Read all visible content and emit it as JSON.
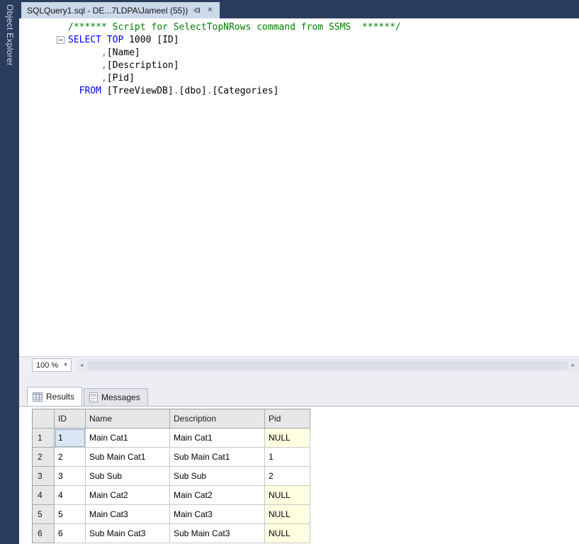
{
  "autohide": {
    "object_explorer_label": "Object Explorer"
  },
  "tab": {
    "title": "SQLQuery1.sql - DE...7LDPA\\Jameel (55))"
  },
  "icons": {
    "close": "✕",
    "caret_down": "▼",
    "scroll_left": "◄",
    "scroll_right": "►"
  },
  "editor": {
    "zoom_level": "100 %",
    "code_lines": [
      [
        [
          "comment",
          "/****** Script for SelectTopNRows command from SSMS  ******/"
        ]
      ],
      [
        [
          "kw",
          "SELECT"
        ],
        [
          "plain",
          " "
        ],
        [
          "kw",
          "TOP"
        ],
        [
          "plain",
          " "
        ],
        [
          "num",
          "1000"
        ],
        [
          "plain",
          " [ID]"
        ]
      ],
      [
        [
          "plain",
          "      "
        ],
        [
          "op",
          ","
        ],
        [
          "plain",
          "[Name]"
        ]
      ],
      [
        [
          "plain",
          "      "
        ],
        [
          "op",
          ","
        ],
        [
          "plain",
          "[Description]"
        ]
      ],
      [
        [
          "plain",
          "      "
        ],
        [
          "op",
          ","
        ],
        [
          "plain",
          "[Pid]"
        ]
      ],
      [
        [
          "plain",
          "  "
        ],
        [
          "kw",
          "FROM"
        ],
        [
          "plain",
          " [TreeViewDB]"
        ],
        [
          "op",
          "."
        ],
        [
          "plain",
          "[dbo]"
        ],
        [
          "op",
          "."
        ],
        [
          "plain",
          "[Categories]"
        ]
      ]
    ]
  },
  "results": {
    "tabs": [
      {
        "label": "Results"
      },
      {
        "label": "Messages"
      }
    ],
    "grid": {
      "columns": [
        "ID",
        "Name",
        "Description",
        "Pid"
      ],
      "rows": [
        {
          "num": "1",
          "cells": [
            "1",
            "Main Cat1",
            "Main Cat1",
            "NULL"
          ]
        },
        {
          "num": "2",
          "cells": [
            "2",
            "Sub Main Cat1",
            "Sub Main Cat1",
            "1"
          ]
        },
        {
          "num": "3",
          "cells": [
            "3",
            "Sub Sub",
            "Sub Sub",
            "2"
          ]
        },
        {
          "num": "4",
          "cells": [
            "4",
            "Main Cat2",
            "Main Cat2",
            "NULL"
          ]
        },
        {
          "num": "5",
          "cells": [
            "5",
            "Main Cat3",
            "Main Cat3",
            "NULL"
          ]
        },
        {
          "num": "6",
          "cells": [
            "6",
            "Sub Main Cat3",
            "Sub Main Cat3",
            "NULL"
          ]
        }
      ],
      "null_text": "NULL",
      "selected_cell": {
        "row": 0,
        "col": 0
      }
    }
  },
  "colors": {
    "frame": "#2b3d5e",
    "active_tab": "#ccd9ea",
    "keyword": "#0000ff",
    "comment": "#008000",
    "null_cell_bg": "#ffffe1",
    "grid_header_bg": "#e6e7e9"
  }
}
